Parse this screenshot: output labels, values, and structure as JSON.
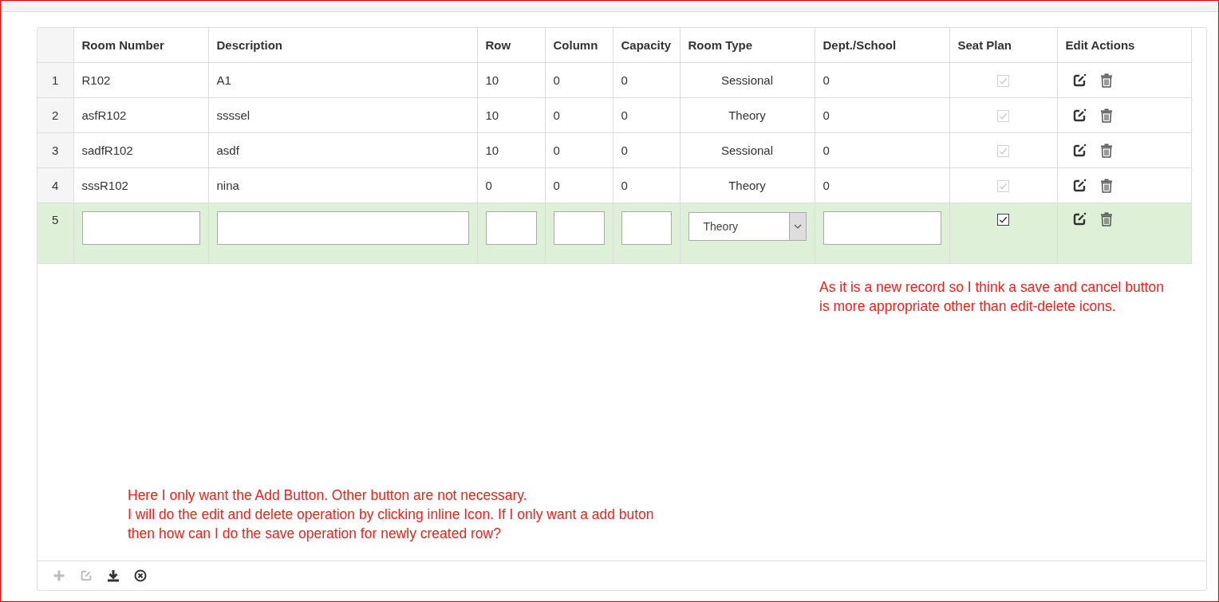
{
  "grid": {
    "columns": [
      "Room Number",
      "Description",
      "Row",
      "Column",
      "Capacity",
      "Room Type",
      "Dept./School",
      "Seat Plan",
      "Edit Actions"
    ],
    "rows": [
      {
        "number": "1",
        "room_number": "R102",
        "description": "A1",
        "row": "10",
        "column": "0",
        "capacity": "0",
        "room_type": "Sessional",
        "dept_school": "0",
        "seat_plan": {
          "checked": true,
          "disabled": true
        }
      },
      {
        "number": "2",
        "room_number": "asfR102",
        "description": "ssssel",
        "row": "10",
        "column": "0",
        "capacity": "0",
        "room_type": "Theory",
        "dept_school": "0",
        "seat_plan": {
          "checked": true,
          "disabled": true
        }
      },
      {
        "number": "3",
        "room_number": "sadfR102",
        "description": "asdf",
        "row": "10",
        "column": "0",
        "capacity": "0",
        "room_type": "Sessional",
        "dept_school": "0",
        "seat_plan": {
          "checked": true,
          "disabled": true
        }
      },
      {
        "number": "4",
        "room_number": "sssR102",
        "description": "nina",
        "row": "0",
        "column": "0",
        "capacity": "0",
        "room_type": "Theory",
        "dept_school": "0",
        "seat_plan": {
          "checked": true,
          "disabled": true
        }
      }
    ],
    "new_row": {
      "number": "5",
      "room_type": "Theory",
      "seat_plan": {
        "checked": true,
        "disabled": false
      }
    }
  },
  "toolbar": [
    {
      "kind": "add",
      "disabled": true
    },
    {
      "kind": "edit",
      "disabled": true
    },
    {
      "kind": "export",
      "disabled": false
    },
    {
      "kind": "cancel",
      "disabled": false
    }
  ],
  "annotations": [
    {
      "kind": "right",
      "lines": [
        "As it is a new record so I think a save and cancel button",
        "is more appropriate other than edit-delete icons."
      ]
    },
    {
      "kind": "bottom",
      "lines": [
        "Here I only want the Add Button. Other button are not necessary.",
        "I will do the edit and delete operation by clicking inline Icon. If I only want a add buton",
        "then how can I do the save operation for newly created row?"
      ]
    }
  ]
}
